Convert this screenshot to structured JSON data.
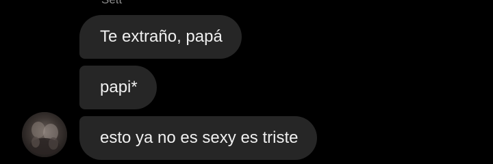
{
  "conversation": {
    "sender_name": "Sett",
    "messages": [
      {
        "text": "Te extraño, papá"
      },
      {
        "text": "papi*"
      },
      {
        "text": "esto ya no es sexy es triste"
      }
    ]
  },
  "colors": {
    "background": "#000000",
    "bubble": "#262626",
    "bubble_text": "#f0f0f0",
    "sender_name": "#8e8e8e"
  },
  "icons": {
    "avatar": "profile-photo-avatar"
  }
}
